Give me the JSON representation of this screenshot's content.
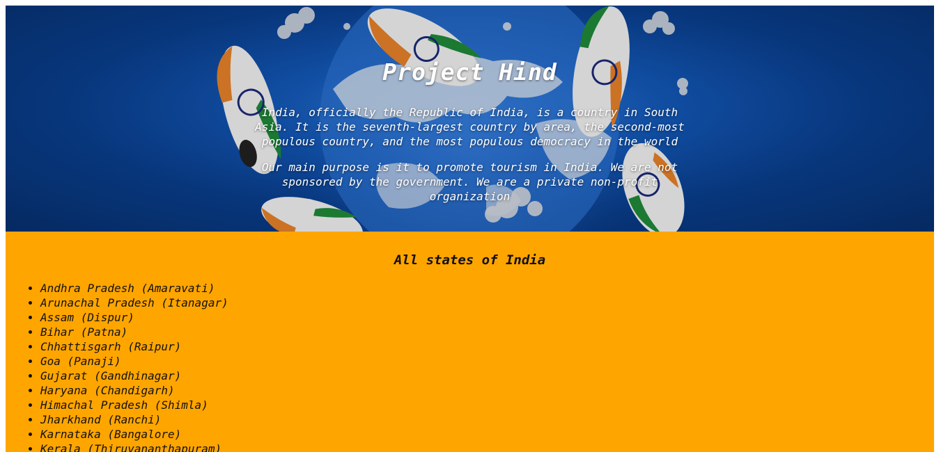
{
  "hero": {
    "title": "Project Hind",
    "paragraph1": "India, officially the Republic of India, is a country in South Asia. It is the seventh-largest country by area, the second-most populous country, and the most populous democracy in the world",
    "paragraph2": "Our main purpose is it to promote tourism in India. We are not sponsored by the government. We are a private non-profit organization",
    "background_color": "#0a3f8f"
  },
  "states": {
    "title": "All states of India",
    "background_color": "#ffa500",
    "items": [
      "Andhra Pradesh (Amaravati)",
      "Arunachal Pradesh (Itanagar)",
      "Assam (Dispur)",
      "Bihar (Patna)",
      "Chhattisgarh (Raipur)",
      "Goa (Panaji)",
      "Gujarat (Gandhinagar)",
      "Haryana (Chandigarh)",
      "Himachal Pradesh (Shimla)",
      "Jharkhand (Ranchi)",
      "Karnataka (Bangalore)",
      "Kerala (Thiruvananthapuram)"
    ]
  }
}
